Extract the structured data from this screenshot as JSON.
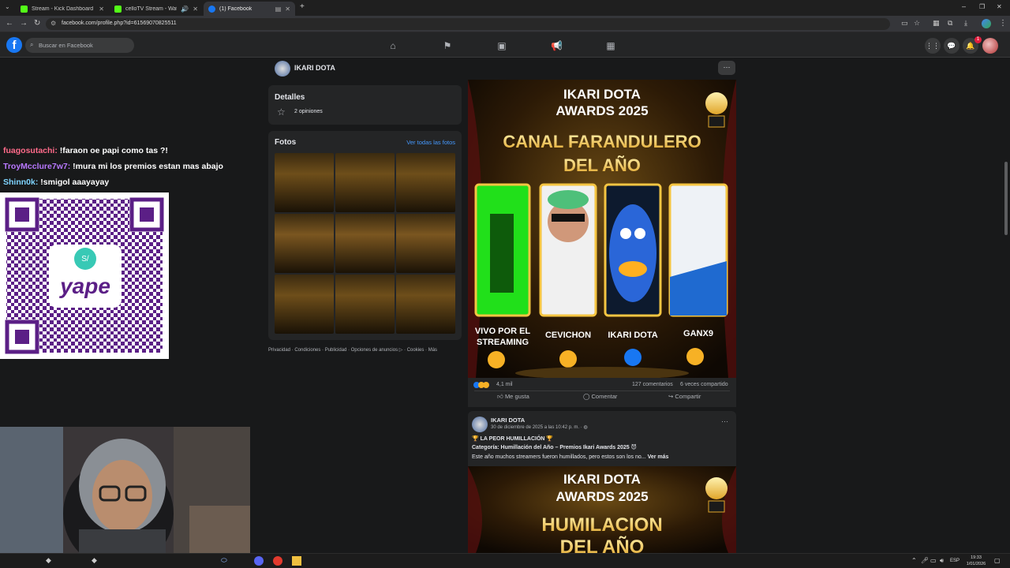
{
  "browser": {
    "tabs": [
      {
        "label": "Stream - Kick Dashboard",
        "active": false
      },
      {
        "label": "celloTV Stream - Watch Liv",
        "active": false
      },
      {
        "label": "(1) Facebook",
        "active": true
      }
    ],
    "url": "facebook.com/profile.php?id=61569070825511"
  },
  "facebook": {
    "search_placeholder": "Buscar en Facebook",
    "profile_name": "IKARI DOTA",
    "notification_count": "1"
  },
  "chat": [
    {
      "user": "fuagosutachi:",
      "message": "!faraon oe papi como tas ?!",
      "color": "#ff6b8a"
    },
    {
      "user": "TroyMcclure7w7:",
      "message": "!mura mi los premios estan mas abajo",
      "color": "#b878ff"
    },
    {
      "user": "Shinn0k:",
      "message": "!smigol aaayayay",
      "color": "#7fd4ff"
    }
  ],
  "qr": {
    "brand": "yape"
  },
  "details": {
    "title": "Detalles",
    "rating_text": "2 opiniones"
  },
  "photos": {
    "title": "Fotos",
    "see_all": "Ver todas las fotos",
    "footer": "Privacidad · Condiciones · Publicidad · Opciones de anuncios ▷ · Cookies · Más"
  },
  "post1": {
    "header_top": "IKARI DOTA",
    "header_mid": "AWARDS 2025",
    "category_line1": "CANAL FARANDULERO",
    "category_line2": "DEL AÑO",
    "nominees": [
      "VIVO POR EL STREAMING",
      "CEVICHON",
      "IKARI DOTA",
      "GANX9"
    ],
    "reactions_count": "4,1 mil",
    "comments": "127 comentarios",
    "shares": "6 veces compartido",
    "like_label": "Me gusta",
    "comment_label": "Comentar",
    "share_label": "Compartir"
  },
  "post2": {
    "author": "IKARI DOTA",
    "date": "30 de diciembre de 2025 a las 10:42 p. m. · ",
    "title": "🏆 LA PEOR HUMILLACIÓN 🏆",
    "category": "Categoría: Humillación del Año – Premios Ikari Awards 2025 😈",
    "body": "Este año muchos streamers fueron humillados, pero estos son los no...",
    "see_more": "Ver más",
    "header_top": "IKARI DOTA",
    "header_mid": "AWARDS 2025",
    "category_line1": "HUMILACION",
    "category_line2": "DEL AÑO"
  },
  "taskbar": {
    "lang": "ESP",
    "time": "19:33",
    "date": "1/01/2026"
  },
  "colors": {
    "fb_blue": "#1877f2",
    "bg": "#18191a",
    "card": "#242526",
    "gold": "#f5c542"
  }
}
